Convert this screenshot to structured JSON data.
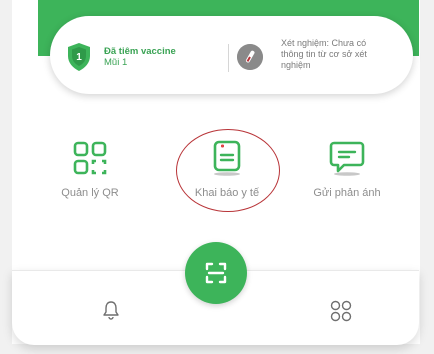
{
  "status_card": {
    "vaccine_title": "Đã tiêm vaccine",
    "vaccine_sub": "Mũi 1",
    "vaccine_badge": "1",
    "test_text": "Xét nghiệm: Chưa có thông tin từ cơ sở xét nghiệm"
  },
  "menu": {
    "items": [
      {
        "label": "Quản lý QR",
        "icon": "qr-grid-icon"
      },
      {
        "label": "Khai báo y tế",
        "icon": "medical-declaration-icon"
      },
      {
        "label": "Gửi phản ánh",
        "icon": "feedback-chat-icon"
      }
    ]
  },
  "bottom_nav": {
    "left_icon": "bell-icon",
    "center_icon": "scan-icon",
    "right_icon": "apps-icon"
  },
  "colors": {
    "brand_green": "#3db45a",
    "highlight_red": "#b83438",
    "label_gray": "#8d8d8d"
  }
}
